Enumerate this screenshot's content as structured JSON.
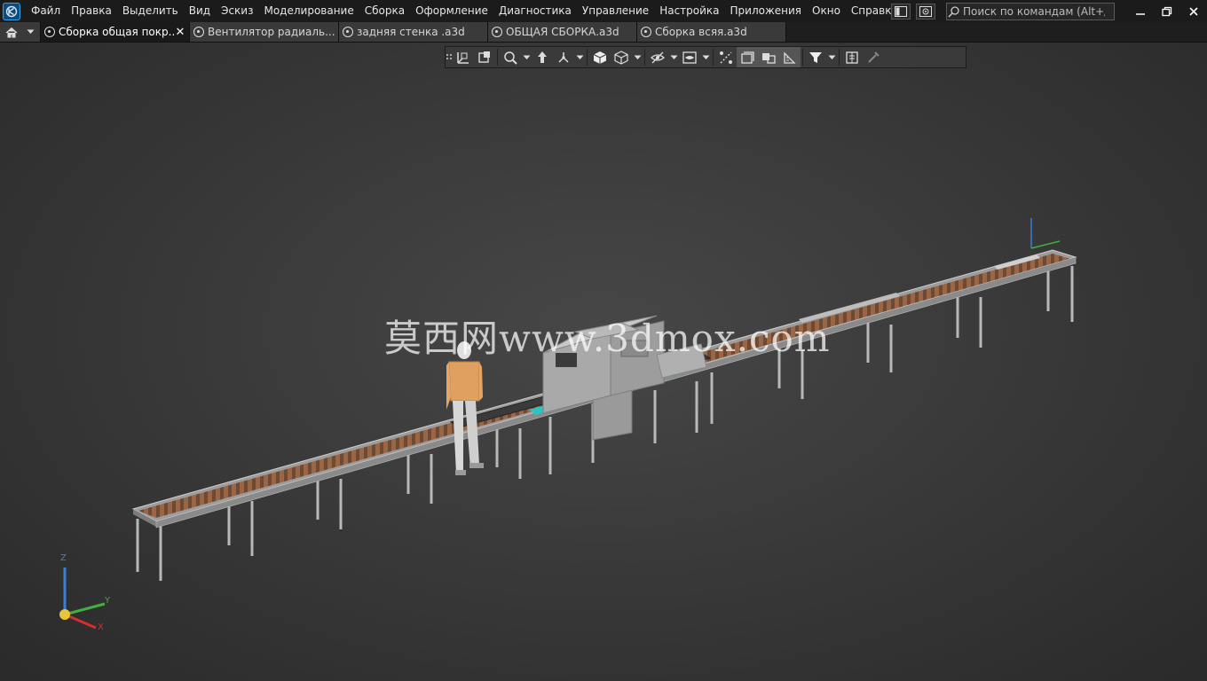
{
  "menu": {
    "items": [
      "Файл",
      "Правка",
      "Выделить",
      "Вид",
      "Эскиз",
      "Моделирование",
      "Сборка",
      "Оформление",
      "Диагностика",
      "Управление",
      "Настройка",
      "Приложения",
      "Окно",
      "Справка"
    ],
    "search_placeholder": "Поиск по командам (Alt+/)"
  },
  "tabs": [
    {
      "label": "Сборка общая покр...",
      "active": true
    },
    {
      "label": "Вентилятор радиаль...",
      "active": false
    },
    {
      "label": "задняя стенка .a3d",
      "active": false
    },
    {
      "label": "ОБЩАЯ СБОРКА.a3d",
      "active": false
    },
    {
      "label": "Сборка всяя.a3d",
      "active": false
    }
  ],
  "tab_close_glyph": "✕",
  "viewport": {
    "watermark": "莫西网www.3dmox.com",
    "triad_labels": {
      "x": "X",
      "y": "Y",
      "z": "Z"
    }
  },
  "colors": {
    "accent": "#3aa0e0",
    "axis_x": "#d03030",
    "axis_y": "#40b040",
    "axis_z": "#3a7fd6",
    "rollers": "#8a5a3a",
    "guide": "#2ec4c4"
  }
}
